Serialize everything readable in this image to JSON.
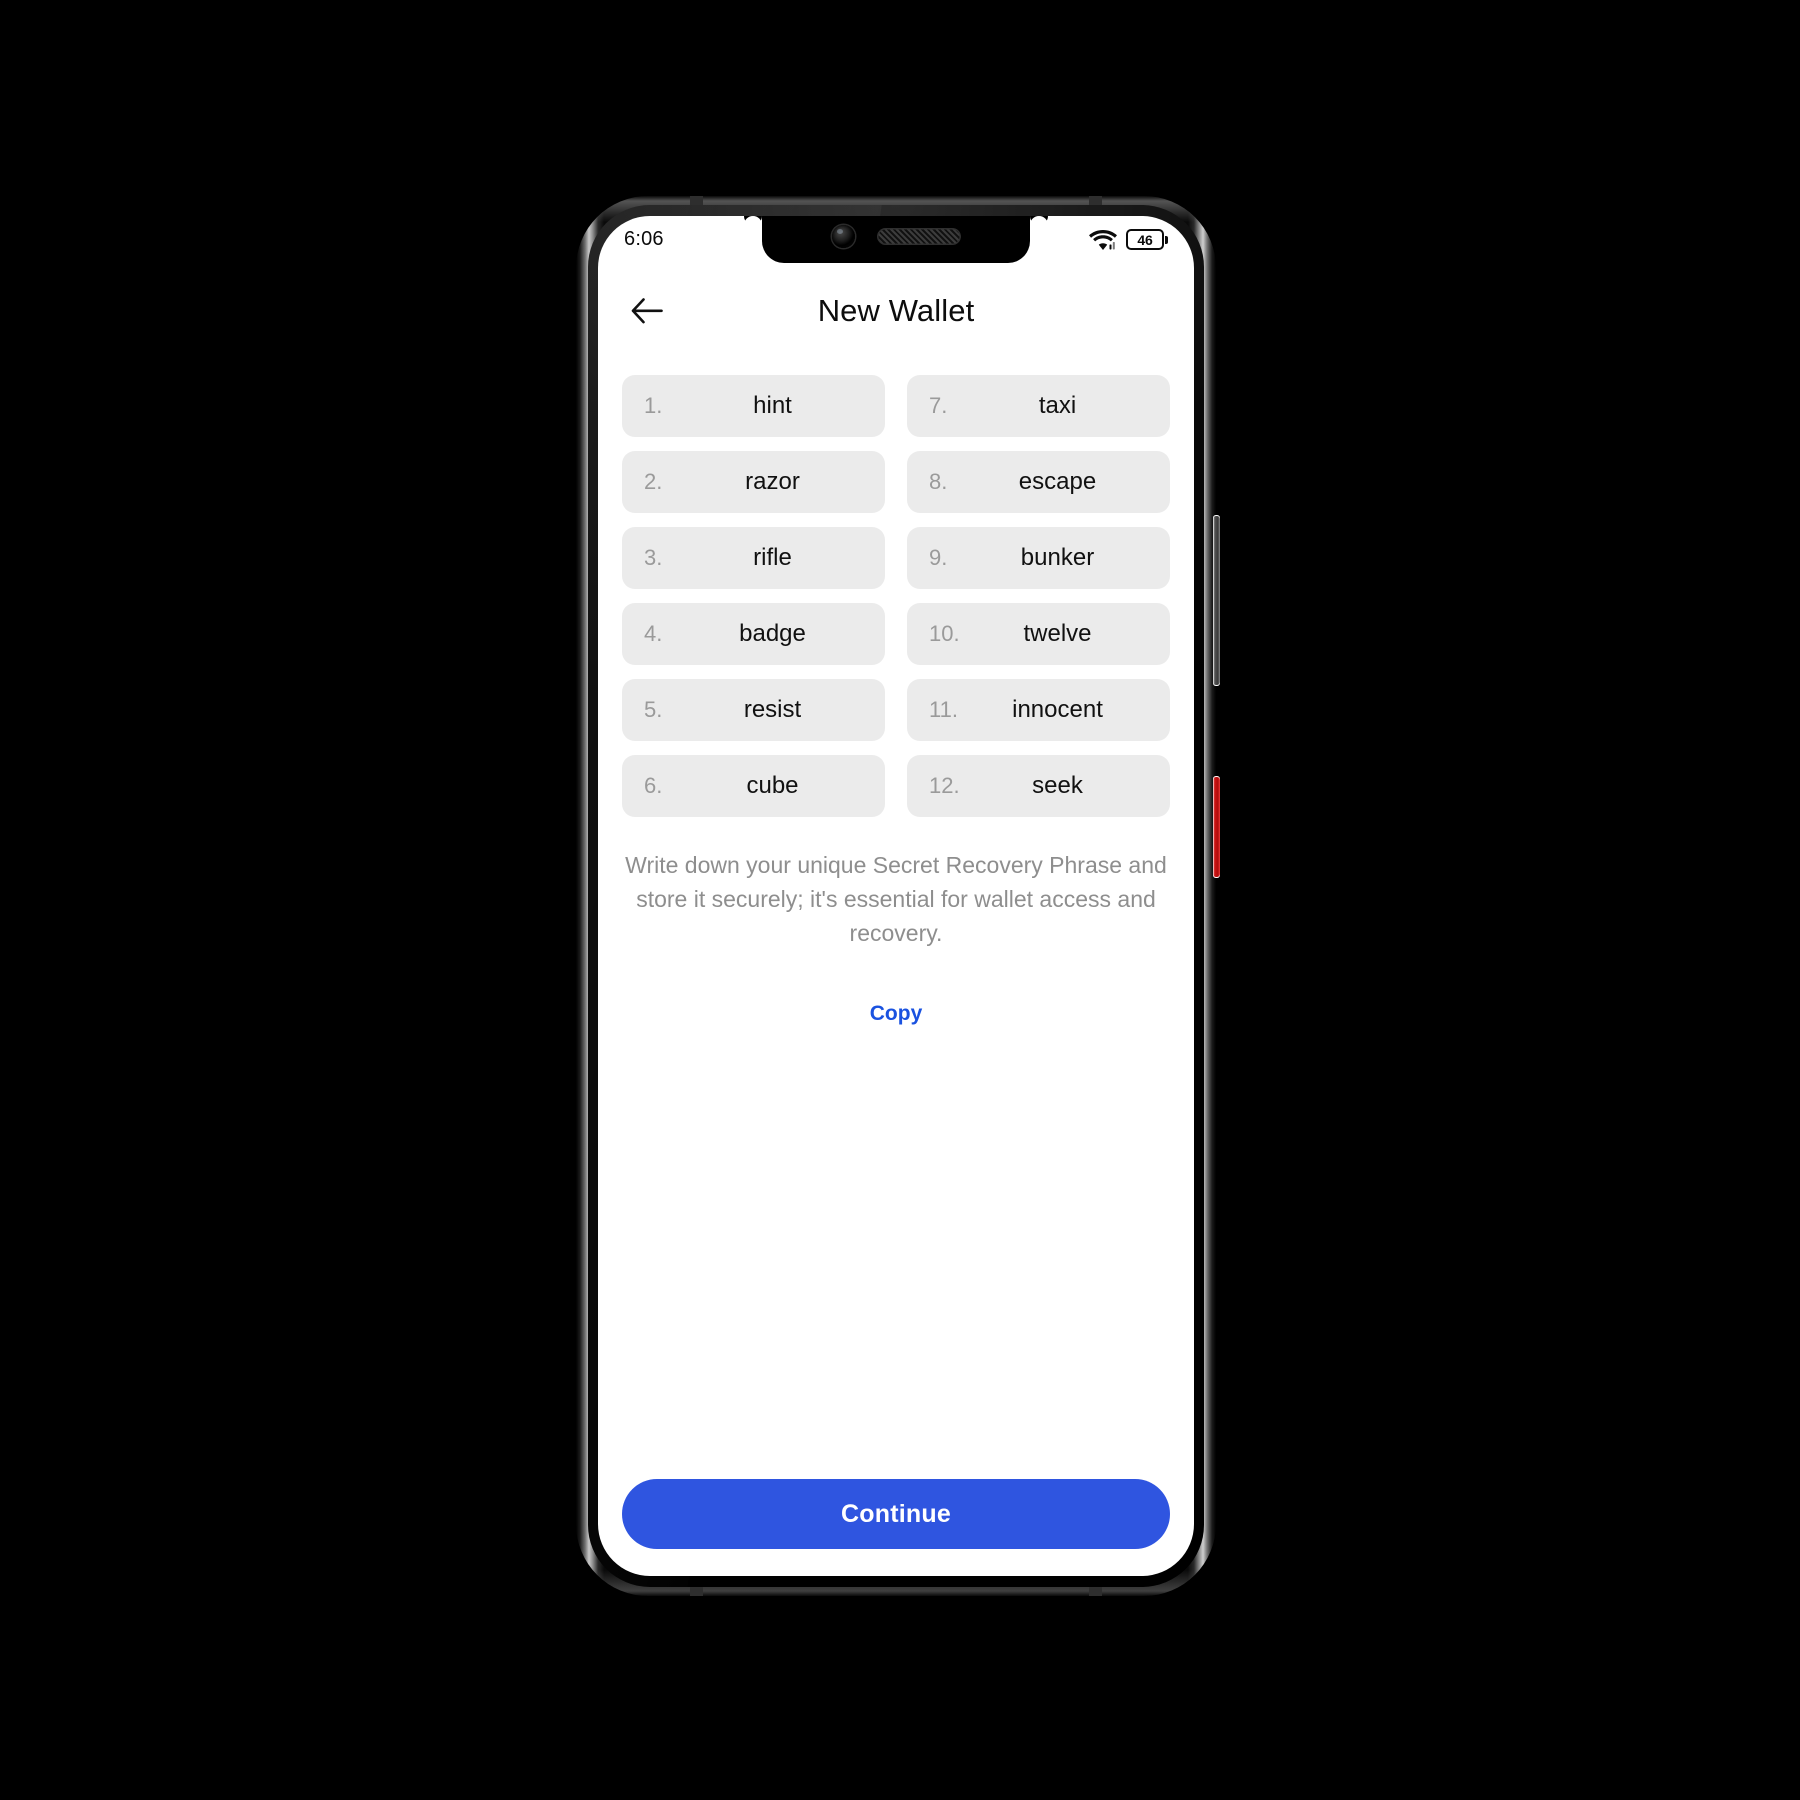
{
  "status_bar": {
    "time": "6:06",
    "wifi_icon": "wifi-icon",
    "battery_level": "46"
  },
  "header": {
    "back_icon": "arrow-left-icon",
    "title": "New Wallet"
  },
  "recovery_phrase": {
    "words": [
      {
        "index": "1.",
        "word": "hint"
      },
      {
        "index": "7.",
        "word": "taxi"
      },
      {
        "index": "2.",
        "word": "razor"
      },
      {
        "index": "8.",
        "word": "escape"
      },
      {
        "index": "3.",
        "word": "rifle"
      },
      {
        "index": "9.",
        "word": "bunker"
      },
      {
        "index": "4.",
        "word": "badge"
      },
      {
        "index": "10.",
        "word": "twelve"
      },
      {
        "index": "5.",
        "word": "resist"
      },
      {
        "index": "11.",
        "word": "innocent"
      },
      {
        "index": "6.",
        "word": "cube"
      },
      {
        "index": "12.",
        "word": "seek"
      }
    ]
  },
  "hint": "Write down your unique Secret Recovery Phrase and store it securely; it's essential for wallet access and recovery.",
  "actions": {
    "copy_label": "Copy",
    "continue_label": "Continue"
  },
  "colors": {
    "accent": "#2f55e0",
    "link": "#1a52e0",
    "pill_bg": "#ebebeb",
    "muted_text": "#8e8e8e",
    "index_text": "#9a9a9a",
    "screen_bg": "#ffffff",
    "page_bg": "#000000",
    "power_button": "#d01515"
  },
  "hardware": {
    "camera": "camera-lens",
    "earpiece": "earpiece-speaker",
    "volume_button": "volume-rocker",
    "power_button": "power-button"
  }
}
